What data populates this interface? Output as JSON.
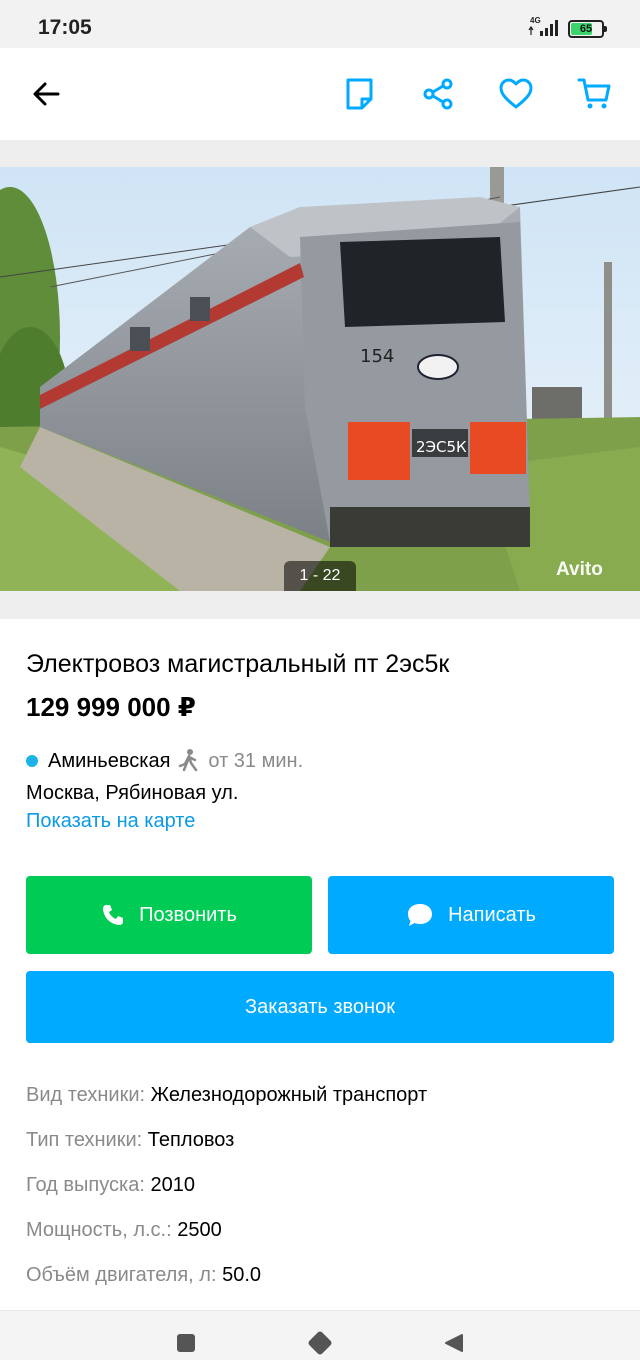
{
  "status_bar": {
    "time": "17:05",
    "network": "4G",
    "battery": "65",
    "battery_level": 0.65
  },
  "toolbar": {
    "back_icon": "arrow-left-icon",
    "note_icon": "note-icon",
    "share_icon": "share-icon",
    "favorite_icon": "heart-icon",
    "cart_icon": "cart-icon",
    "accent": "#00aaff"
  },
  "gallery": {
    "counter": "1 - 22",
    "watermark": "Avito",
    "locomotive_number": "154",
    "locomotive_model": "2ЭС5К"
  },
  "listing": {
    "title": "Электровоз магистральный пт 2эс5к",
    "price": "129 999 000 ₽",
    "metro_station": "Аминьевская",
    "metro_color": "#1ab4e8",
    "walk_time": "от 31 мин.",
    "address": "Москва, Рябиновая ул.",
    "map_link": "Показать на карте"
  },
  "actions": {
    "call_label": "Позвонить",
    "write_label": "Написать",
    "order_call_label": "Заказать звонок",
    "call_color": "#00cc55",
    "write_color": "#00aaff"
  },
  "specs": [
    {
      "key": "Вид техники:",
      "value": "Железнодорожный транспорт"
    },
    {
      "key": "Тип техники:",
      "value": "Тепловоз"
    },
    {
      "key": "Год выпуска:",
      "value": "2010"
    },
    {
      "key": "Мощность, л.с.:",
      "value": "2500"
    },
    {
      "key": "Объём двигателя, л:",
      "value": "50.0"
    }
  ],
  "navbar": {
    "recents_icon": "square-icon",
    "home_icon": "diamond-icon",
    "back_icon": "triangle-back-icon"
  }
}
